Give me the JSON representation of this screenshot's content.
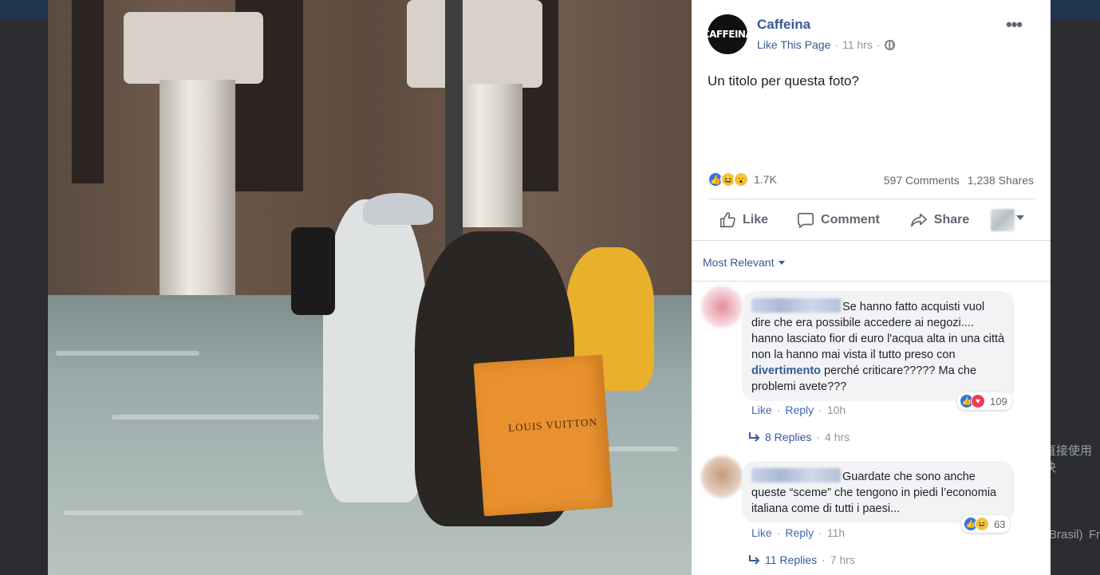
{
  "post": {
    "page_name": "Caffeina",
    "avatar_text": "CAFFEINA",
    "like_page": "Like This Page",
    "time": "11 hrs",
    "text": "Un titolo per questa foto?",
    "reactions_count": "1.7K",
    "comments_count": "597 Comments",
    "shares_count": "1,238 Shares",
    "actions": {
      "like": "Like",
      "comment": "Comment",
      "share": "Share"
    },
    "photo_bag_text": "LOUIS VUITTON"
  },
  "comments": {
    "sort_label": "Most Relevant",
    "items": [
      {
        "text_before": "Se hanno fatto acquisti vuol dire che era possibile accedere ai negozi.... hanno lasciato fior di euro l'acqua alta in una città non la hanno mai vista il tutto preso con ",
        "highlight": "divertimento",
        "text_after": " perché criticare????? Ma che problemi avete???",
        "reaction_count": "109",
        "like": "Like",
        "reply": "Reply",
        "time": "10h",
        "replies_label": "8 Replies",
        "replies_time": "4 hrs"
      },
      {
        "text_before": "Guardate che sono anche queste “sceme” che tengono in piedi l’economia italiana come di tutti i paesi...",
        "highlight": "",
        "text_after": "",
        "reaction_count": "63",
        "like": "Like",
        "reply": "Reply",
        "time": "11h",
        "replies_label": "11 Replies",
        "replies_time": "7 hrs"
      }
    ]
  },
  "background_edge": {
    "text1": "直接使用快",
    "text2": "Brasil)",
    "text3": "Fr"
  },
  "colors": {
    "link": "#385898",
    "like_blue": "#2f74e8",
    "love_red": "#ef3b55",
    "haha_yellow": "#f7c242"
  },
  "icons": [
    "globe-icon",
    "more-icon",
    "like-icon",
    "comment-icon",
    "share-icon",
    "reply-arrow-icon",
    "caret-down-icon"
  ]
}
